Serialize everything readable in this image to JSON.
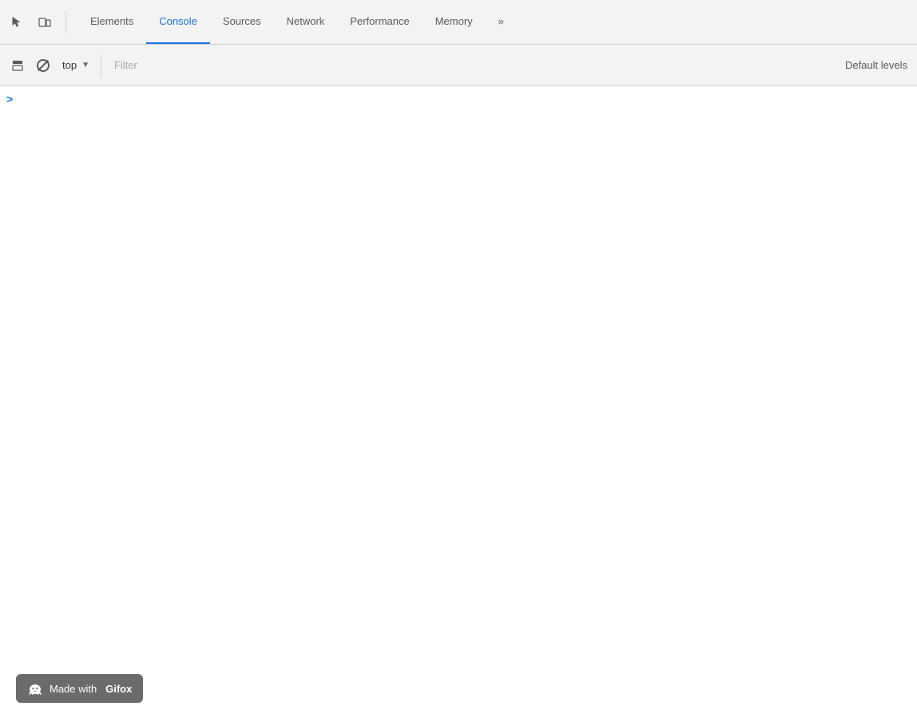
{
  "tabbar": {
    "tabs": [
      {
        "id": "elements",
        "label": "Elements",
        "active": false
      },
      {
        "id": "console",
        "label": "Console",
        "active": true
      },
      {
        "id": "sources",
        "label": "Sources",
        "active": false
      },
      {
        "id": "network",
        "label": "Network",
        "active": false
      },
      {
        "id": "performance",
        "label": "Performance",
        "active": false
      },
      {
        "id": "memory",
        "label": "Memory",
        "active": false
      },
      {
        "id": "more",
        "label": "»",
        "active": false
      }
    ]
  },
  "secondary": {
    "context": "top",
    "filter_placeholder": "Filter",
    "default_levels": "Default levels"
  },
  "console": {
    "prompt_symbol": ">"
  },
  "badge": {
    "made_with": "Made with",
    "brand": "Gifox"
  }
}
